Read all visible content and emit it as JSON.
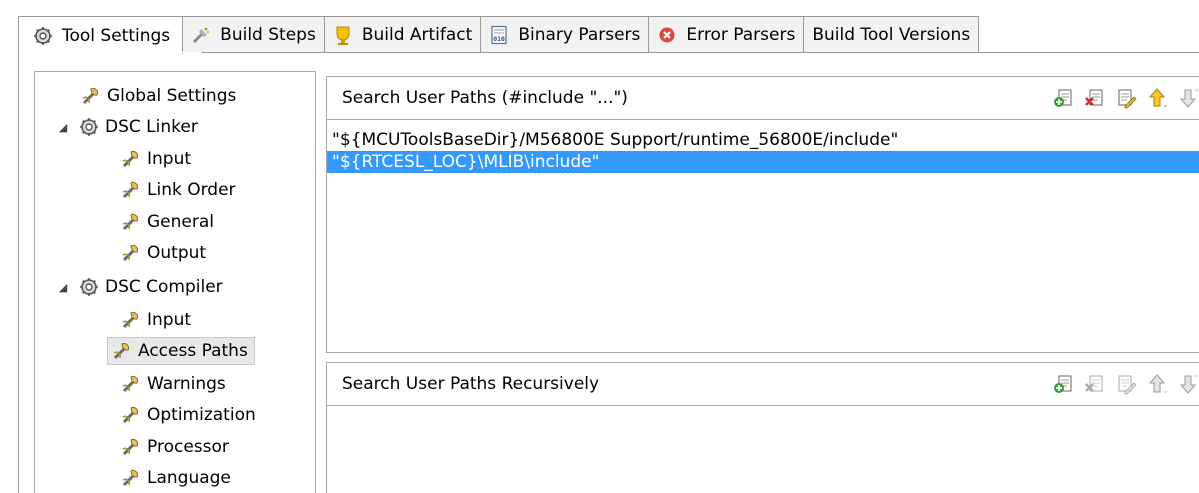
{
  "tabs": [
    {
      "label": "Tool Settings",
      "icon": "gear-icon",
      "active": true
    },
    {
      "label": "Build Steps",
      "icon": "build-steps-icon"
    },
    {
      "label": "Build Artifact",
      "icon": "artifact-icon"
    },
    {
      "label": "Binary Parsers",
      "icon": "binary-icon"
    },
    {
      "label": "Error Parsers",
      "icon": "error-icon"
    },
    {
      "label": "Build Tool Versions",
      "icon": ""
    }
  ],
  "tree": {
    "items": [
      {
        "label": "Global Settings",
        "icon": "tool-icon",
        "level": 1
      },
      {
        "label": "DSC Linker",
        "icon": "gear-icon",
        "level": 0,
        "expanded": true
      },
      {
        "label": "Input",
        "icon": "tool-icon",
        "level": 2
      },
      {
        "label": "Link Order",
        "icon": "tool-icon",
        "level": 2
      },
      {
        "label": "General",
        "icon": "tool-icon",
        "level": 2
      },
      {
        "label": "Output",
        "icon": "tool-icon",
        "level": 2
      },
      {
        "label": "DSC Compiler",
        "icon": "gear-icon",
        "level": 0,
        "expanded": true
      },
      {
        "label": "Input",
        "icon": "tool-icon",
        "level": 2
      },
      {
        "label": "Access Paths",
        "icon": "tool-icon",
        "level": 2,
        "selected": true
      },
      {
        "label": "Warnings",
        "icon": "tool-icon",
        "level": 2
      },
      {
        "label": "Optimization",
        "icon": "tool-icon",
        "level": 2
      },
      {
        "label": "Processor",
        "icon": "tool-icon",
        "level": 2
      },
      {
        "label": "Language",
        "icon": "tool-icon",
        "level": 2
      }
    ]
  },
  "user_paths": {
    "title": "Search User Paths (#include \"...\")",
    "toolbar_icons": [
      "add-icon",
      "delete-icon",
      "edit-icon",
      "move-up-icon",
      "move-down-icon"
    ],
    "rows": [
      {
        "text": "\"${MCUToolsBaseDir}/M56800E Support/runtime_56800E/include\"",
        "selected": false
      },
      {
        "text": "\"${RTCESL_LOC}\\MLIB\\include\"",
        "selected": true
      }
    ]
  },
  "recursive_paths": {
    "title": "Search User Paths Recursively",
    "toolbar_icons": [
      "add-icon",
      "delete-icon",
      "edit-icon",
      "move-up-icon",
      "move-down-icon"
    ],
    "rows": []
  },
  "colors": {
    "selection": "#3399ff",
    "tree_selection": "#e8e8e8",
    "border": "#a8a8a8"
  }
}
